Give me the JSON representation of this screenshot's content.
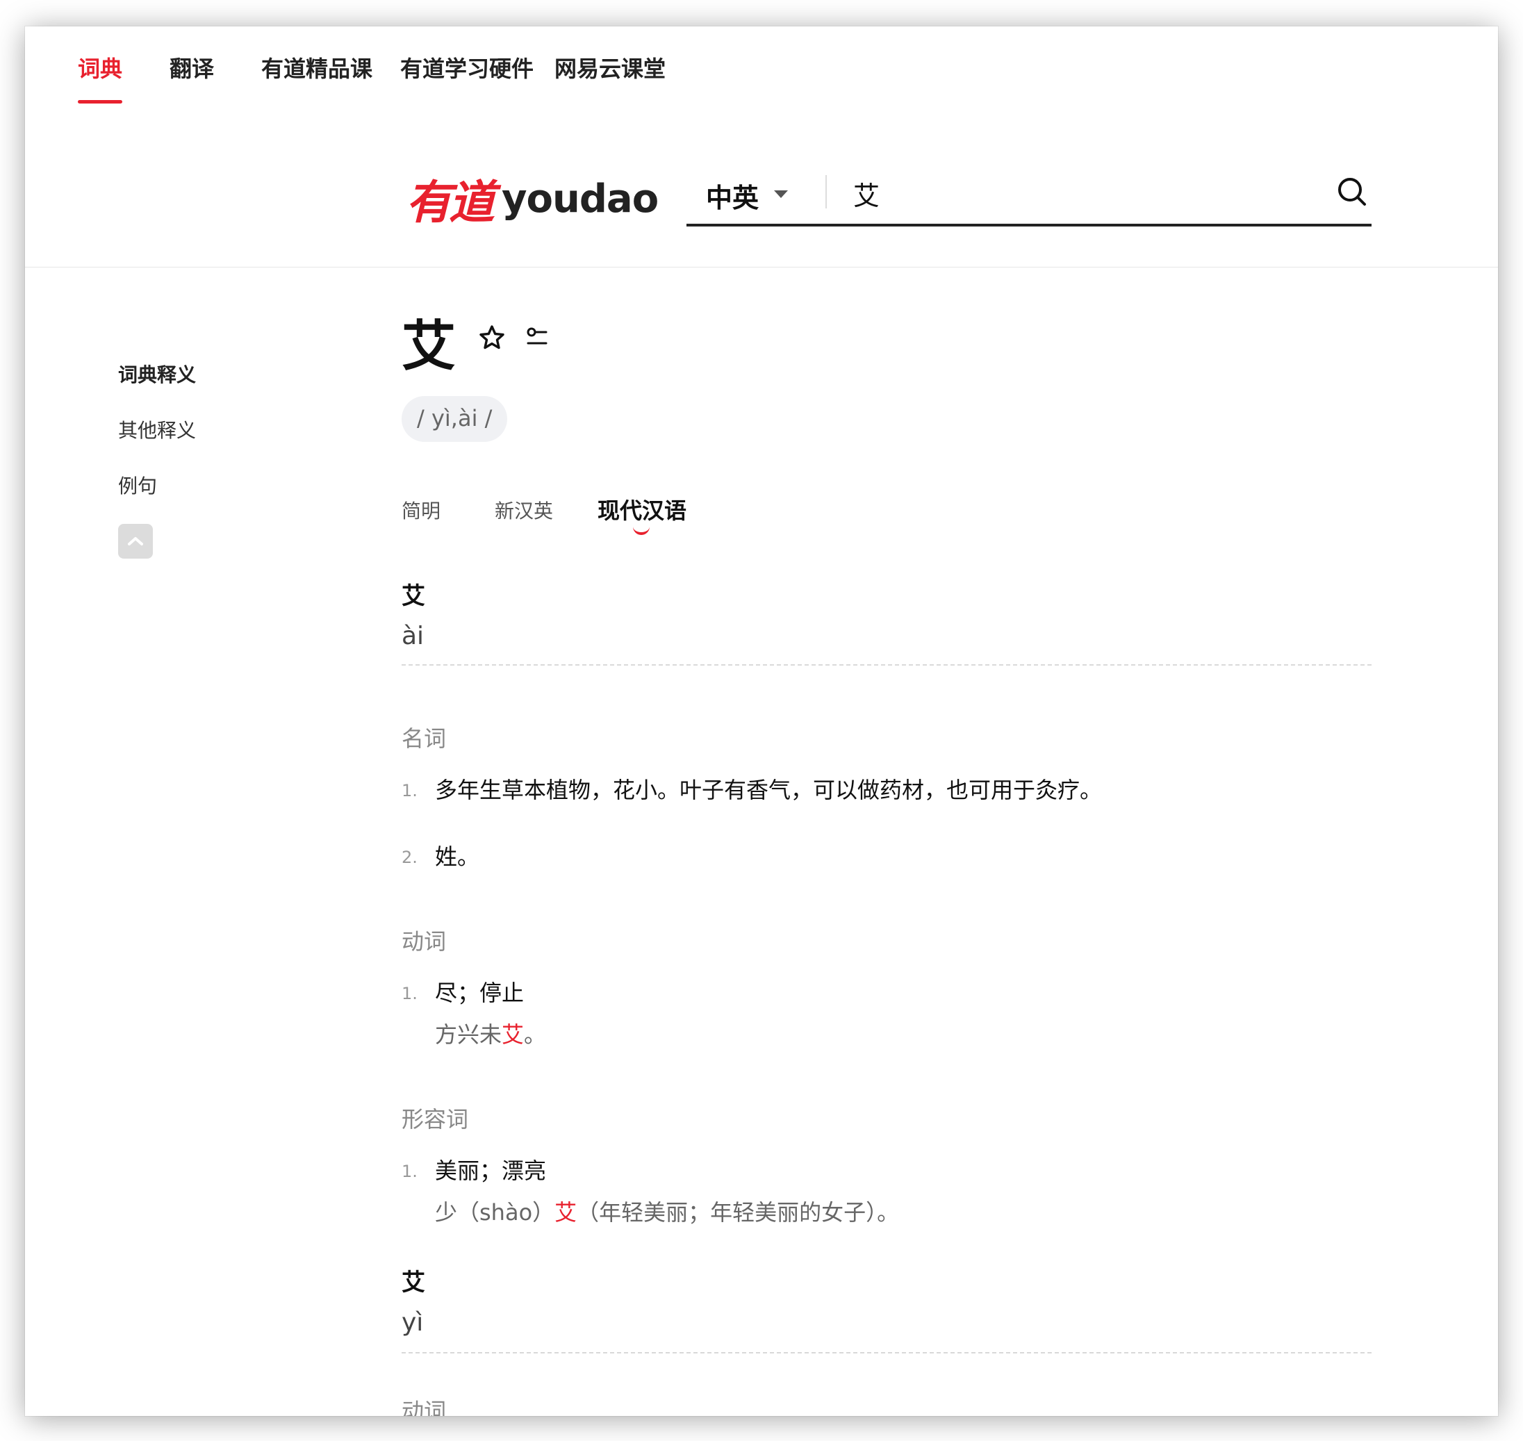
{
  "nav": {
    "items": [
      "词典",
      "翻译",
      "有道精品课",
      "有道学习硬件",
      "网易云课堂"
    ],
    "active_index": 0
  },
  "logo": {
    "cn": "有道",
    "en": "youdao"
  },
  "search": {
    "lang": "中英",
    "value": "艾"
  },
  "sidebar": {
    "items": [
      "词典释义",
      "其他释义",
      "例句"
    ]
  },
  "word": {
    "headword": "艾",
    "phonetic": "/ yì,ài /"
  },
  "tabs": {
    "items": [
      "简明",
      "新汉英",
      "现代汉语"
    ],
    "active_index": 2
  },
  "entries": [
    {
      "char": "艾",
      "pinyin": "ài",
      "groups": [
        {
          "pos": "名词",
          "senses": [
            {
              "num": "1.",
              "text": "多年生草本植物，花小。叶子有香气，可以做药材，也可用于灸疗。"
            },
            {
              "num": "2.",
              "text": "姓。"
            }
          ]
        },
        {
          "pos": "动词",
          "senses": [
            {
              "num": "1.",
              "text": "尽；停止",
              "example": {
                "before": "方兴未",
                "highlight": "艾",
                "after": "。"
              }
            }
          ]
        },
        {
          "pos": "形容词",
          "senses": [
            {
              "num": "1.",
              "text": "美丽；漂亮",
              "example": {
                "before": "少（shào）",
                "highlight": "艾",
                "after": "（年轻美丽；年轻美丽的女子）。"
              }
            }
          ]
        }
      ]
    },
    {
      "char": "艾",
      "pinyin": "yì",
      "groups": [
        {
          "pos": "动词",
          "senses": []
        }
      ]
    }
  ],
  "colors": {
    "accent": "#e8212e",
    "text": "#111111",
    "muted": "#888888"
  },
  "icons": [
    "search-icon",
    "star-icon",
    "word-list-icon",
    "chevron-up-icon",
    "dropdown-caret-icon"
  ]
}
